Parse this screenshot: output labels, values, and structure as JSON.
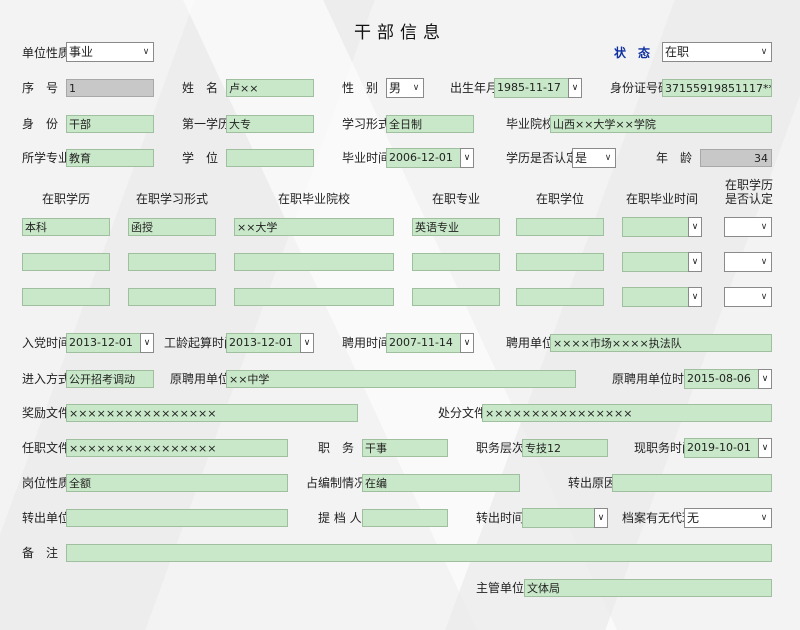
{
  "title": "干部信息",
  "top": {
    "unit_type": {
      "label": "单位性质",
      "value": "事业"
    },
    "status": {
      "label": "状　态",
      "value": "在职"
    }
  },
  "row1": {
    "seq": {
      "label": "序　号",
      "value": "1"
    },
    "name": {
      "label": "姓　名",
      "value": "卢××"
    },
    "gender": {
      "label": "性　别",
      "value": "男"
    },
    "birth": {
      "label": "出生年月",
      "value": "1985-11-17"
    },
    "id_no": {
      "label": "身份证号码",
      "value": "37155919851117****"
    }
  },
  "row2": {
    "identity": {
      "label": "身　份",
      "value": "干部"
    },
    "first_edu": {
      "label": "第一学历",
      "value": "大专"
    },
    "study_form": {
      "label": "学习形式",
      "value": "全日制"
    },
    "grad_school": {
      "label": "毕业院校",
      "value": "山西××大学××学院"
    }
  },
  "row3": {
    "major": {
      "label": "所学专业",
      "value": "教育"
    },
    "degree": {
      "label": "学　位",
      "value": ""
    },
    "grad_time": {
      "label": "毕业时间",
      "value": "2006-12-01"
    },
    "edu_certified": {
      "label": "学历是否认定",
      "value": "是"
    },
    "age": {
      "label": "年　龄",
      "value": "34"
    }
  },
  "inservice": {
    "headers": [
      "在职学历",
      "在职学习形式",
      "在职毕业院校",
      "在职专业",
      "在职学位",
      "在职毕业时间",
      "在职学历是否认定"
    ],
    "rows": [
      {
        "edu": "本科",
        "form": "函授",
        "school": "××大学",
        "major": "英语专业",
        "degree": "",
        "time": "",
        "certified": ""
      },
      {
        "edu": "",
        "form": "",
        "school": "",
        "major": "",
        "degree": "",
        "time": "",
        "certified": ""
      },
      {
        "edu": "",
        "form": "",
        "school": "",
        "major": "",
        "degree": "",
        "time": "",
        "certified": ""
      }
    ]
  },
  "row4": {
    "party_time": {
      "label": "入党时间",
      "value": "2013-12-01"
    },
    "seniority_start": {
      "label": "工龄起算时间",
      "value": "2013-12-01"
    },
    "hire_time": {
      "label": "聘用时间",
      "value": "2007-11-14"
    },
    "hire_unit": {
      "label": "聘用单位",
      "value": "××××市场××××执法队"
    }
  },
  "row5": {
    "entry_method": {
      "label": "进入方式",
      "value": "公开招考调动"
    },
    "orig_unit": {
      "label": "原聘用单位",
      "value": "××中学"
    },
    "orig_unit_time": {
      "label": "原聘用单位时间",
      "value": "2015-08-06"
    }
  },
  "row6": {
    "award_doc": {
      "label": "奖励文件",
      "value": "××××××××××××××××"
    },
    "punish_doc": {
      "label": "处分文件",
      "value": "××××××××××××××××"
    }
  },
  "row7": {
    "appoint_doc": {
      "label": "任职文件",
      "value": "××××××××××××××××"
    },
    "duty": {
      "label": "职　务",
      "value": "干事"
    },
    "duty_level": {
      "label": "职务层次",
      "value": "专技12"
    },
    "duty_time": {
      "label": "现职务时间",
      "value": "2019-10-01"
    }
  },
  "row8": {
    "post_nature": {
      "label": "岗位性质",
      "value": "全额"
    },
    "staffing": {
      "label": "占编制情况",
      "value": "在编"
    },
    "transfer_reason": {
      "label": "转出原因",
      "value": ""
    }
  },
  "row9": {
    "transfer_unit": {
      "label": "转出单位",
      "value": ""
    },
    "file_taker": {
      "label": "提 档 人",
      "value": ""
    },
    "transfer_time": {
      "label": "转出时间",
      "value": ""
    },
    "file_agent": {
      "label": "档案有无代理",
      "value": "无"
    }
  },
  "row10": {
    "remark": {
      "label": "备　注",
      "value": ""
    }
  },
  "row11": {
    "supervisor": {
      "label": "主管单位:",
      "value": "文体局"
    }
  },
  "icons": {
    "dropdown": "▾",
    "spin": "∨"
  },
  "colors": {
    "field_green": "#c9e8c9",
    "field_gray": "#c8c8c8",
    "status_blue": "#1030a0"
  }
}
